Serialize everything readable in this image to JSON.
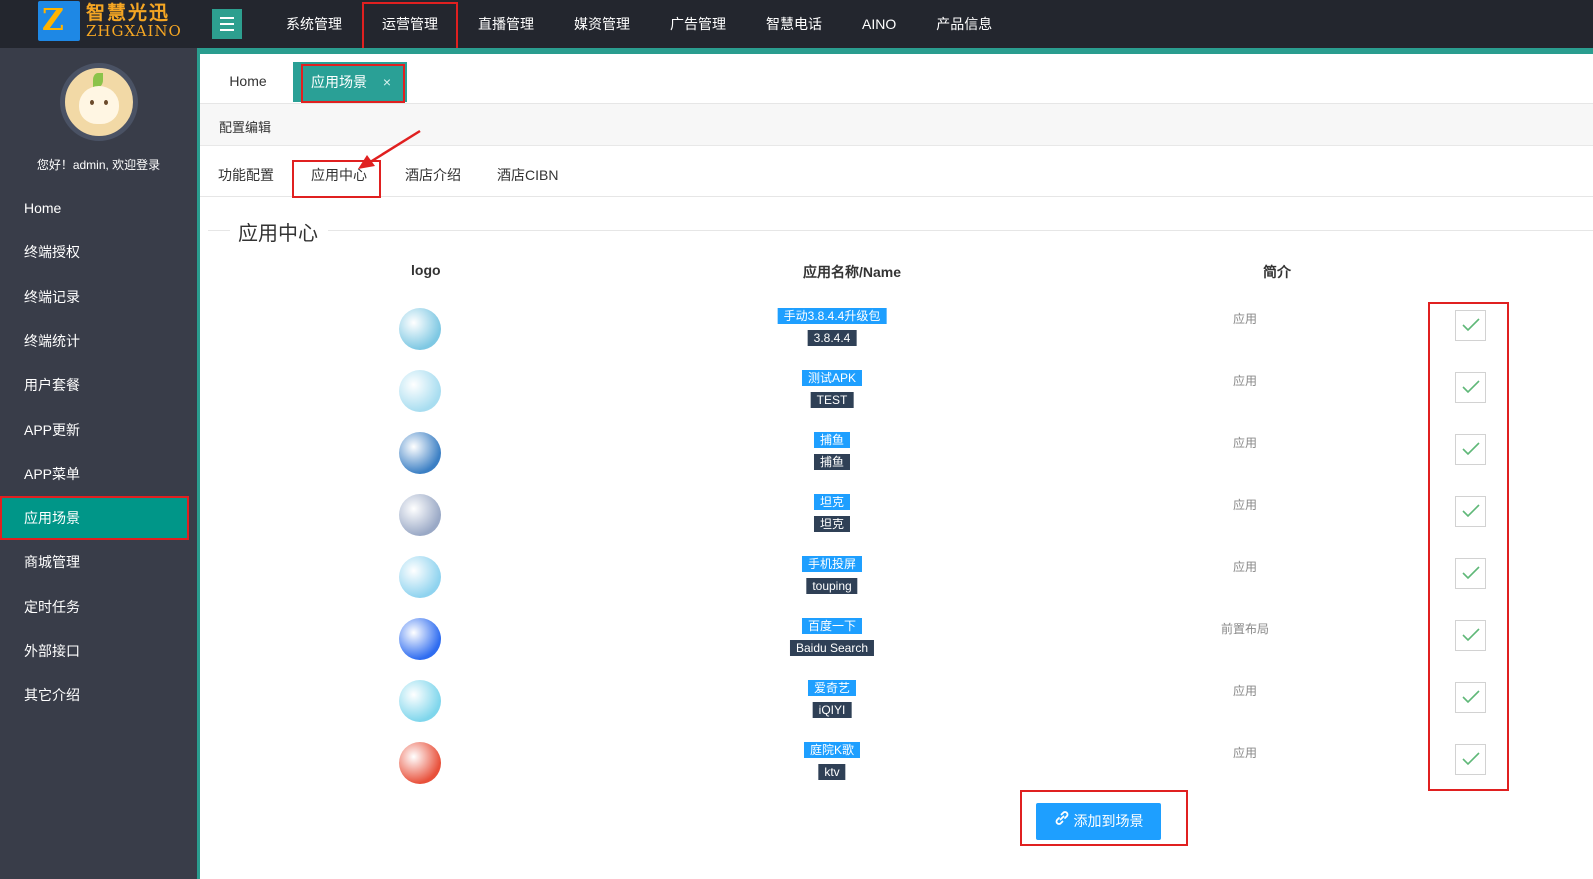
{
  "brand": {
    "name_cn": "智慧光迅",
    "name_en": "ZHGXAINO",
    "logo_letter": "Z"
  },
  "top_nav": [
    {
      "label": "系统管理"
    },
    {
      "label": "运营管理",
      "active": true
    },
    {
      "label": "直播管理"
    },
    {
      "label": "媒资管理"
    },
    {
      "label": "广告管理"
    },
    {
      "label": "智慧电话"
    },
    {
      "label": "AINO"
    },
    {
      "label": "产品信息"
    }
  ],
  "sidebar": {
    "welcome": "您好！admin, 欢迎登录",
    "items": [
      {
        "label": "Home"
      },
      {
        "label": "终端授权"
      },
      {
        "label": "终端记录"
      },
      {
        "label": "终端统计"
      },
      {
        "label": "用户套餐"
      },
      {
        "label": "APP更新"
      },
      {
        "label": "APP菜单"
      },
      {
        "label": "应用场景",
        "active": true
      },
      {
        "label": "商城管理"
      },
      {
        "label": "定时任务"
      },
      {
        "label": "外部接口"
      },
      {
        "label": "其它介绍"
      }
    ]
  },
  "tabs": {
    "home": "Home",
    "active": "应用场景",
    "close": "×"
  },
  "breadcrumb": "配置编辑",
  "subtabs": [
    "功能配置",
    "应用中心",
    "酒店介绍",
    "酒店CIBN"
  ],
  "section_title": "应用中心",
  "table": {
    "headers": {
      "logo": "logo",
      "name": "应用名称/Name",
      "desc": "简介"
    },
    "rows": [
      {
        "name": "手动3.8.4.4升级包",
        "code": "3.8.4.4",
        "desc": "应用",
        "checked": true,
        "logo_color": "#7ec8e3"
      },
      {
        "name": "测试APK",
        "code": "TEST",
        "desc": "应用",
        "checked": true,
        "logo_color": "#a8ddf0"
      },
      {
        "name": "捕鱼",
        "code": "捕鱼",
        "desc": "应用",
        "checked": true,
        "logo_color": "#3b7fc4"
      },
      {
        "name": "坦克",
        "code": "坦克",
        "desc": "应用",
        "checked": true,
        "logo_color": "#9aa9c6"
      },
      {
        "name": "手机投屏",
        "code": "touping",
        "desc": "应用",
        "checked": true,
        "logo_color": "#8fd3ef"
      },
      {
        "name": "百度一下",
        "code": "Baidu Search",
        "desc": "前置布局",
        "checked": true,
        "logo_color": "#2e6cf0"
      },
      {
        "name": "爱奇艺",
        "code": "iQIYI",
        "desc": "应用",
        "checked": true,
        "logo_color": "#7fd6ec"
      },
      {
        "name": "庭院K歌",
        "code": "ktv",
        "desc": "应用",
        "checked": true,
        "logo_color": "#e8503a"
      }
    ]
  },
  "add_button": {
    "label": "添加到场景",
    "icon": "link-icon"
  },
  "colors": {
    "topbar": "#23262e",
    "sidebar": "#393d49",
    "teal": "#009688",
    "blue": "#1e9fff",
    "annotation": "#e02020"
  }
}
